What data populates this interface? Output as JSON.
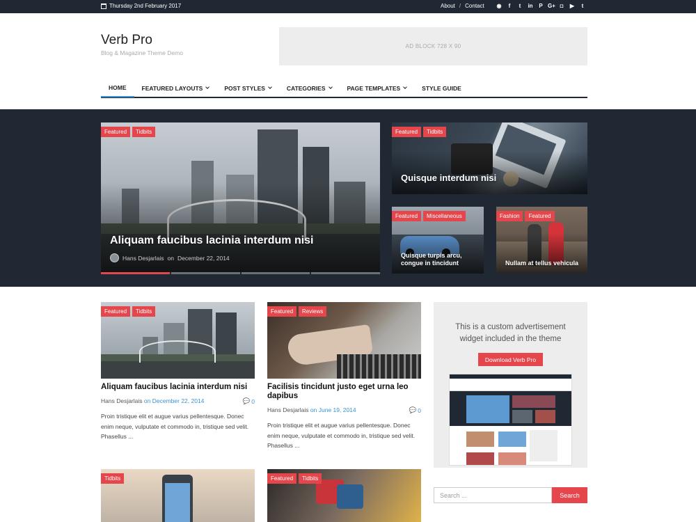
{
  "topbar": {
    "date": "Thursday 2nd February 2017",
    "links": [
      "About",
      "/",
      "Contact"
    ],
    "social_icons": [
      "rss-icon",
      "facebook-icon",
      "twitter-icon",
      "linkedin-icon",
      "pinterest-icon",
      "google-plus-icon",
      "instagram-icon",
      "youtube-icon",
      "tumblr-icon"
    ]
  },
  "header": {
    "site_title": "Verb Pro",
    "site_description": "Blog & Magazine Theme Demo",
    "ad_block": "AD BLOCK  728 X 90"
  },
  "nav": {
    "items": [
      {
        "label": "HOME",
        "active": true,
        "dropdown": false
      },
      {
        "label": "FEATURED LAYOUTS",
        "dropdown": true
      },
      {
        "label": "POST STYLES",
        "dropdown": true
      },
      {
        "label": "CATEGORIES",
        "dropdown": true
      },
      {
        "label": "PAGE TEMPLATES",
        "dropdown": true
      },
      {
        "label": "STYLE GUIDE",
        "dropdown": false
      }
    ]
  },
  "featured": {
    "main": {
      "tags": [
        "Featured",
        "Tidbits"
      ],
      "title": "Aliquam faucibus lacinia interdum nisi",
      "author": "Hans Desjarlais",
      "on": "on",
      "date": "December 22, 2014"
    },
    "top_right": {
      "tags": [
        "Featured",
        "Tidbits"
      ],
      "title": "Quisque interdum nisi"
    },
    "bottom_left": {
      "tags": [
        "Featured",
        "Miscellaneous"
      ],
      "title": "Quisque turpis arcu, congue in tincidunt"
    },
    "bottom_right": {
      "tags": [
        "Fashion",
        "Featured"
      ],
      "title": "Nullam at tellus vehicula"
    }
  },
  "posts": [
    {
      "tags": [
        "Featured",
        "Tidbits"
      ],
      "title": "Aliquam faucibus lacinia interdum nisi",
      "author": "Hans Desjarlais",
      "on": "on",
      "date": "December 22, 2014",
      "comments": "0",
      "excerpt": "Proin tristique elit et augue varius pellentesque. Donec enim neque, vulputate et commodo in, tristique sed velit. Phasellus ..."
    },
    {
      "tags": [
        "Featured",
        "Reviews"
      ],
      "title": "Facilisis tincidunt justo eget urna leo dapibus",
      "author": "Hans Desjarlais",
      "on": "on",
      "date": "June 19, 2014",
      "comments": "0",
      "excerpt": "Proin tristique elit et augue varius pellentesque. Donec enim neque, vulputate et commodo in, tristique sed velit. Phasellus ..."
    },
    {
      "tags": [
        "Tidbits"
      ]
    },
    {
      "tags": [
        "Featured",
        "Tidbits"
      ]
    }
  ],
  "sidebar": {
    "widget_text": "This is a custom advertisement widget included in the theme",
    "button": "Download Verb Pro",
    "search_placeholder": "Search ...",
    "search_button": "Search"
  },
  "colors": {
    "accent": "#e5464c",
    "dark": "#1f2833",
    "link": "#3a92d2"
  }
}
